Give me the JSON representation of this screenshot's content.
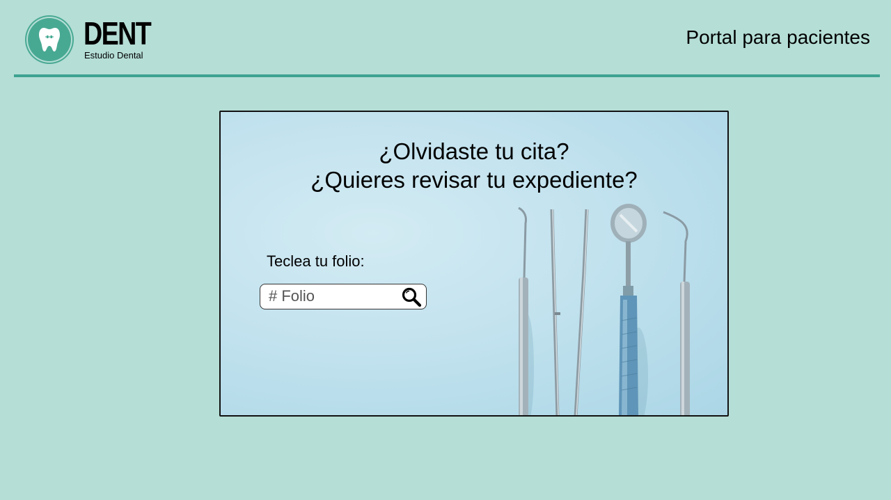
{
  "brand": {
    "name": "DENT",
    "subtitle": "Estudio Dental",
    "logo_icon": "tooth-icon"
  },
  "header": {
    "title": "Portal para pacientes"
  },
  "card": {
    "title_line1": "¿Olvidaste tu cita?",
    "title_line2": "¿Quieres revisar tu expediente?",
    "folio_label": "Teclea tu folio:",
    "search": {
      "placeholder": "# Folio",
      "icon": "search-icon"
    },
    "image": "dental-instruments-photo"
  },
  "colors": {
    "background": "#b5ded6",
    "accent": "#3ea391",
    "logo": "#48a993",
    "card_bg": "#c2e2ee"
  }
}
